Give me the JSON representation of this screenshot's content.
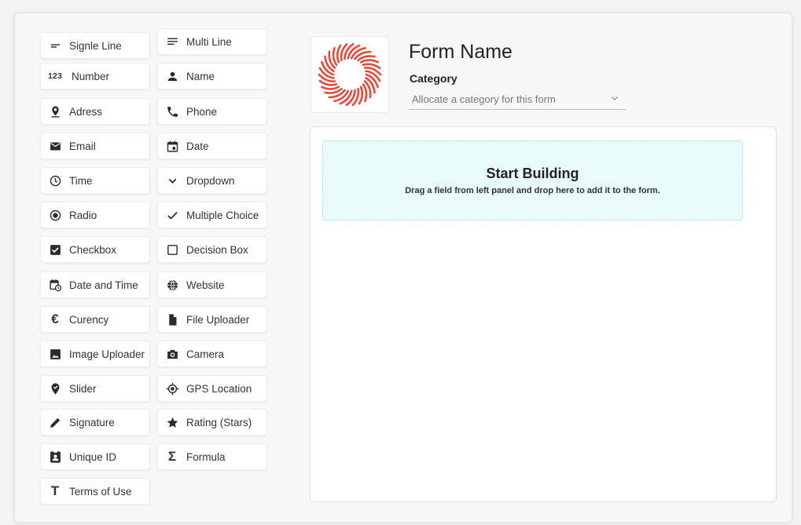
{
  "palette": {
    "left": [
      {
        "label": "Signle Line",
        "icon": "short-text-icon"
      },
      {
        "label": "Number",
        "icon": "number-icon",
        "glyph": "123"
      },
      {
        "label": "Adress",
        "icon": "location-pin-icon"
      },
      {
        "label": "Email",
        "icon": "email-icon"
      },
      {
        "label": "Time",
        "icon": "clock-icon"
      },
      {
        "label": "Radio",
        "icon": "radio-icon"
      },
      {
        "label": "Checkbox",
        "icon": "checkbox-icon"
      },
      {
        "label": "Date and Time",
        "icon": "calendar-clock-icon"
      },
      {
        "label": "Curency",
        "icon": "euro-icon",
        "glyph": "€"
      },
      {
        "label": "Image Uploader",
        "icon": "image-icon"
      },
      {
        "label": "Slider",
        "icon": "slider-pin-icon"
      },
      {
        "label": "Signature",
        "icon": "pen-icon"
      },
      {
        "label": "Unique ID",
        "icon": "id-badge-icon"
      },
      {
        "label": "Terms of Use",
        "icon": "text-t-icon",
        "glyph": "T"
      }
    ],
    "right": [
      {
        "label": "Multi Line",
        "icon": "multiline-icon"
      },
      {
        "label": "Name",
        "icon": "person-icon"
      },
      {
        "label": "Phone",
        "icon": "phone-icon"
      },
      {
        "label": "Date",
        "icon": "calendar-icon"
      },
      {
        "label": "Dropdown",
        "icon": "chevron-down-icon"
      },
      {
        "label": "Multiple Choice",
        "icon": "check-icon"
      },
      {
        "label": "Decision Box",
        "icon": "empty-checkbox-icon"
      },
      {
        "label": "Website",
        "icon": "globe-icon"
      },
      {
        "label": "File Uploader",
        "icon": "file-icon"
      },
      {
        "label": "Camera",
        "icon": "camera-icon"
      },
      {
        "label": "GPS Location",
        "icon": "gps-icon"
      },
      {
        "label": "Rating (Stars)",
        "icon": "star-icon"
      },
      {
        "label": "Formula",
        "icon": "sigma-icon",
        "glyph": "Σ"
      }
    ]
  },
  "form": {
    "title": "Form Name",
    "category_label": "Category",
    "category_placeholder": "Allocate a category for this form",
    "logo_color": "#e8493b"
  },
  "canvas": {
    "drop_title": "Start Building",
    "drop_subtitle": "Drag a field from left panel and drop here to add it to the form."
  }
}
